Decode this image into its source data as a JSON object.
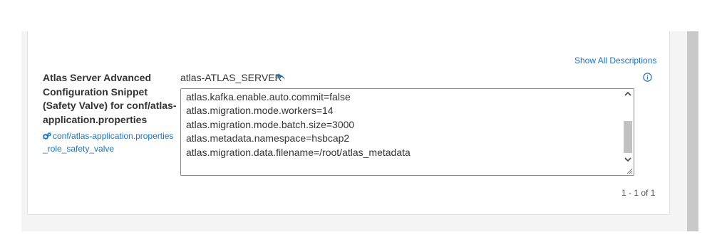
{
  "header": {
    "show_all_descriptions": "Show All Descriptions"
  },
  "property": {
    "label": "Atlas Server Advanced Configuration Snippet (Safety Valve) for conf/atlas-application.properties",
    "key": "conf/atlas-application.properties_role_safety_valve",
    "key_icon": "gears-icon",
    "role_group": "atlas-ATLAS_SERVER",
    "undo_icon": "undo-arrow-icon",
    "info_icon": "info-circle-icon",
    "value_lines": "atlas.kafka.enable.auto.commit=false\natlas.migration.mode.workers=14\natlas.migration.mode.batch.size=3000\natlas.metadata.namespace=hsbcap2\natlas.migration.data.filename=/root/atlas_metadata"
  },
  "pagination": {
    "text": "1 - 1 of 1"
  },
  "colors": {
    "link": "#1a73c6",
    "text": "#333333",
    "background_panel": "#f4f4f4",
    "page_scrollbar": "#c9c9c9"
  }
}
